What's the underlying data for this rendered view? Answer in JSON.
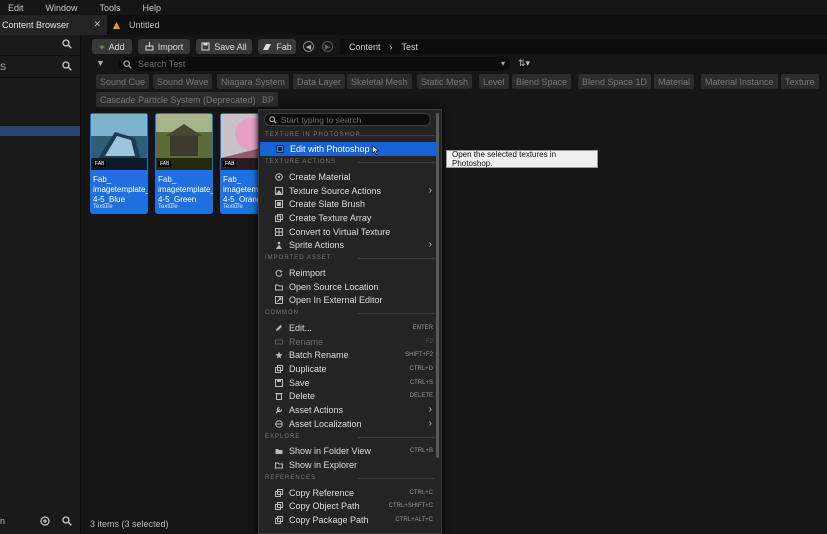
{
  "menubar": [
    "Edit",
    "Window",
    "Tools",
    "Help"
  ],
  "tabs": {
    "active": "Content Browser",
    "close": "✕",
    "second": "Untitled"
  },
  "sidebar": {
    "row2_label": "S",
    "bottom_label": "n"
  },
  "toolbar": {
    "add": "Add",
    "import": "Import",
    "save_all": "Save All",
    "fab": "Fab",
    "path": [
      "Content",
      "Test"
    ],
    "path_sep": "›"
  },
  "search": {
    "placeholder": "Search Test"
  },
  "filters": [
    "Sound Cue",
    "Sound Wave",
    "Niagara System",
    "Data Layer",
    "Skeletal Mesh",
    "Static Mesh",
    "Level",
    "Blend Space",
    "Blend Space 1D",
    "Material",
    "Material Instance",
    "Texture",
    "Cascade Particle System (Deprecated)",
    "BP"
  ],
  "assets": [
    {
      "name": "Fab_ imagetemplate_ 4-5_Blue",
      "type": "Texture",
      "badge": "FAB"
    },
    {
      "name": "Fab_ imagetemplate_ 4-5_Green",
      "type": "Texture",
      "badge": "FAB"
    },
    {
      "name": "Fab_ imagetemplate_ 4-5_Orange",
      "type": "Texture",
      "badge": "FAB"
    }
  ],
  "status": "3 items (3 selected)",
  "context_menu": {
    "search_placeholder": "Start typing to search",
    "sections": {
      "photoshop": "TEXTURE IN PHOTOSHOP",
      "texture_actions": "TEXTURE ACTIONS",
      "imported": "IMPORTED ASSET",
      "common": "COMMON",
      "explore": "EXPLORE",
      "references": "REFERENCES"
    },
    "items": {
      "edit_photoshop": "Edit with Photoshop",
      "create_material": "Create Material",
      "texture_source_actions": "Texture Source Actions",
      "create_slate_brush": "Create Slate Brush",
      "create_texture_array": "Create Texture Array",
      "convert_virtual": "Convert to Virtual Texture",
      "sprite_actions": "Sprite Actions",
      "reimport": "Reimport",
      "open_source_location": "Open Source Location",
      "open_external": "Open In External Editor",
      "edit": "Edit...",
      "rename": "Rename",
      "batch_rename": "Batch Rename",
      "duplicate": "Duplicate",
      "save": "Save",
      "delete": "Delete",
      "asset_actions": "Asset Actions",
      "asset_localization": "Asset Localization",
      "show_folder_view": "Show in Folder View",
      "show_explorer": "Show in Explorer",
      "copy_reference": "Copy Reference",
      "copy_object_path": "Copy Object Path",
      "copy_package_path": "Copy Package Path"
    },
    "shortcuts": {
      "edit": "ENTER",
      "rename": "F2",
      "batch_rename": "SHIFT+F2",
      "duplicate": "CTRL+D",
      "save": "CTRL+S",
      "delete": "DELETE",
      "show_folder_view": "CTRL+B",
      "copy_reference": "CTRL+C",
      "copy_object_path": "CTRL+SHIFT+C",
      "copy_package_path": "CTRL+ALT+C"
    }
  },
  "tooltip": "Open the selected textures in Photoshop.",
  "colors": {
    "accent": "#1762d4",
    "thumb_bg": "#1e6fe0",
    "panel": "#242424"
  }
}
